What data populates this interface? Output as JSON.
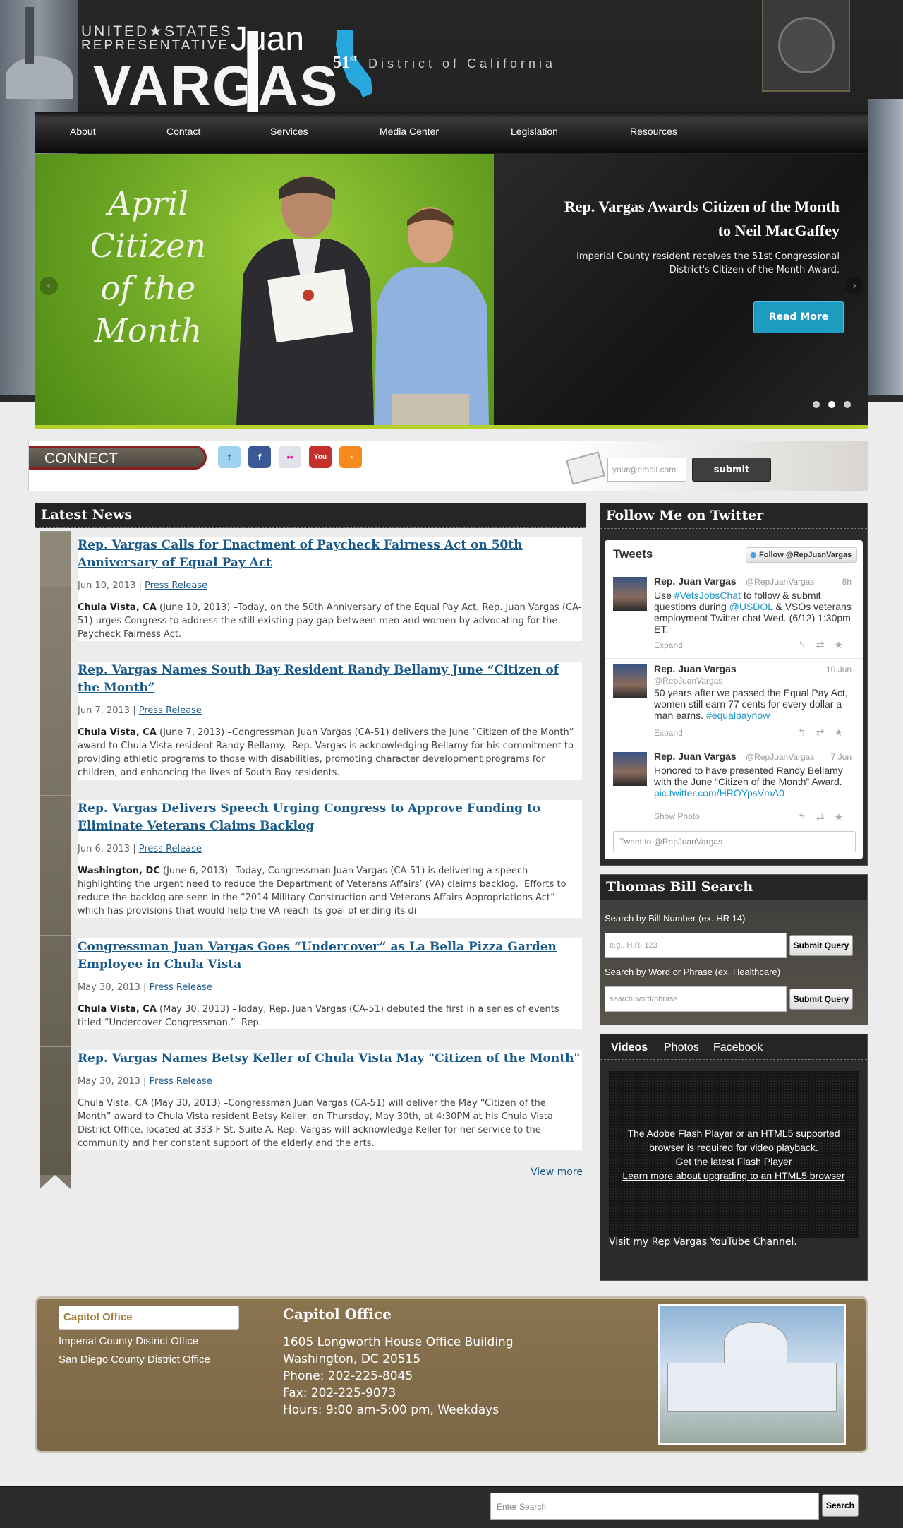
{
  "header": {
    "united_states": "UNITED★STATES",
    "representative": "REPRESENTATIVE",
    "first_name": "Juan",
    "last_name": "VARGAS",
    "district_number": "51",
    "district_suffix": "st",
    "district_text": "District of California"
  },
  "nav": [
    "About",
    "Contact",
    "Services",
    "Media Center",
    "Legislation",
    "Resources"
  ],
  "slider": {
    "script_lines": [
      "April",
      "Citizen",
      "of the",
      "Month"
    ],
    "title": "Rep. Vargas Awards Citizen of the Month to Neil MacGaffey",
    "description": "Imperial County resident receives the 51st Congressional District's Citizen of the Month Award.",
    "button": "Read More",
    "prev_arrow": "‹",
    "next_arrow": "›"
  },
  "connect": {
    "label": "CONNECT",
    "social_icons": [
      {
        "name": "twitter-icon",
        "glyph": "t",
        "color": "#4aa3df"
      },
      {
        "name": "facebook-icon",
        "glyph": "f",
        "color": "#3b5998"
      },
      {
        "name": "flickr-icon",
        "glyph": "••",
        "color": "#e0e4ea"
      },
      {
        "name": "youtube-icon",
        "glyph": "You",
        "color": "#c4302b"
      },
      {
        "name": "rss-icon",
        "glyph": "◔",
        "color": "#f58a1f"
      }
    ],
    "email_placeholder": "your@email.com",
    "submit": "submit"
  },
  "news": {
    "heading": "Latest News",
    "articles": [
      {
        "title": "Rep. Vargas Calls for Enactment of Paycheck Fairness Act on 50th Anniversary of Equal Pay Act",
        "date": "Jun 10, 2013",
        "category": "Press Release",
        "location": "Chula Vista, CA",
        "body": "(June 10, 2013) –Today, on the 50th Anniversary of the Equal Pay Act, Rep. Juan Vargas (CA-51) urges Congress to address the still existing pay gap between men and women by advocating for the Paycheck Fairness Act."
      },
      {
        "title": "Rep. Vargas Names South Bay Resident Randy Bellamy June “Citizen of the Month”",
        "date": "Jun 7, 2013",
        "category": "Press Release",
        "location": "Chula Vista, CA",
        "body": "(June 7, 2013) –Congressman Juan Vargas (CA-51) delivers the June “Citizen of the Month” award to Chula Vista resident Randy Bellamy.  Rep. Vargas is acknowledging Bellamy for his commitment to providing athletic programs to those with disabilities, promoting character development programs for children, and enhancing the lives of South Bay residents."
      },
      {
        "title": "Rep. Vargas Delivers Speech Urging Congress to Approve Funding to Eliminate Veterans Claims Backlog",
        "date": "Jun 6, 2013",
        "category": "Press Release",
        "location": "Washington, DC",
        "body": "(June 6, 2013) –Today, Congressman Juan Vargas (CA-51) is delivering a speech highlighting the urgent need to reduce the Department of Veterans Affairs’ (VA) claims backlog.  Efforts to reduce the backlog are seen in the “2014 Military Construction and Veterans Affairs Appropriations Act” which has provisions that would help the VA reach its goal of ending its di"
      },
      {
        "title": "Congressman Juan Vargas Goes “Undercover” as La Bella Pizza Garden Employee in Chula Vista",
        "date": "May 30, 2013",
        "category": "Press Release",
        "location": "Chula Vista, CA",
        "body": "(May 30, 2013) –Today, Rep. Juan Vargas (CA-51) debuted the first in a series of events titled “Undercover Congressman.”  Rep."
      },
      {
        "title": "Rep. Vargas Names Betsy Keller of Chula Vista May \"Citizen of the Month\"",
        "date": "May 30, 2013",
        "category": "Press Release",
        "location": "",
        "body": "Chula Vista, CA (May 30, 2013) –Congressman Juan Vargas (CA-51) will deliver the May “Citizen of the Month” award to Chula Vista resident Betsy Keller, on Thursday, May 30th, at 4:30PM at his Chula Vista District Office, located at 333 F St. Suite A. Rep. Vargas will acknowledge Keller for her service to the community and her constant support of the elderly and the arts."
      }
    ],
    "view_more": "View more"
  },
  "twitter": {
    "heading": "Follow Me on Twitter",
    "tweets_title": "Tweets",
    "follow_button": "Follow @RepJuanVargas",
    "tweets": [
      {
        "name": "Rep. Juan Vargas",
        "handle": "@RepJuanVargas",
        "time": "8h",
        "text_pre": "Use ",
        "tag1": "#VetsJobsChat",
        "text_mid": " to follow & submit questions during ",
        "tag2": "@USDOL",
        "text_post": " & VSOs veterans employment Twitter chat Wed. (6/12) 1:30pm ET.",
        "action": "Expand"
      },
      {
        "name": "Rep. Juan Vargas",
        "handle": "@RepJuanVargas",
        "time": "10 Jun",
        "text_pre": "50 years after we passed the Equal Pay Act, women still earn 77 cents for every dollar a man earns. ",
        "tag1": "#equalpaynow",
        "text_mid": "",
        "tag2": "",
        "text_post": "",
        "action": "Expand"
      },
      {
        "name": "Rep. Juan Vargas",
        "handle": "@RepJuanVargas",
        "time": "7 Jun",
        "text_pre": "Honored to have presented Randy Bellamy with the June “Citizen of the Month” Award. ",
        "tag1": "pic.twitter.com/HROYpsVmA0",
        "text_mid": "",
        "tag2": "",
        "text_post": "",
        "action": "Show Photo"
      }
    ],
    "actions": "↰⇄★",
    "tweet_placeholder": "Tweet to @RepJuanVargas"
  },
  "thomas": {
    "heading": "Thomas Bill Search",
    "bill_label": "Search by Bill Number (ex. HR 14)",
    "bill_placeholder": "e.g., H.R. 123",
    "word_label": "Search by Word or Phrase (ex. Healthcare)",
    "word_placeholder": "search word/phrase",
    "submit": "Submit Query"
  },
  "media": {
    "tabs": [
      "Videos",
      "Photos",
      "Facebook"
    ],
    "flash_msg": "The Adobe Flash Player or an HTML5 supported browser is required for video playback.",
    "flash_link1": "Get the latest Flash Player",
    "flash_link2": "Learn more about upgrading to an HTML5 browser",
    "visit_pre": "Visit my ",
    "visit_link": "Rep Vargas YouTube Channel",
    "visit_post": "."
  },
  "office": {
    "selected": "Capitol Office",
    "other_offices": [
      "Imperial County District Office",
      "San Diego County District Office"
    ],
    "title": "Capitol Office",
    "lines": [
      "1605 Longworth House Office Building",
      "Washington, DC 20515",
      "Phone: 202-225-8045",
      "Fax: 202-225-9073",
      "Hours: 9:00 am-5:00 pm, Weekdays"
    ]
  },
  "footer": {
    "search_placeholder": "Enter Search",
    "search_button": "Search"
  }
}
